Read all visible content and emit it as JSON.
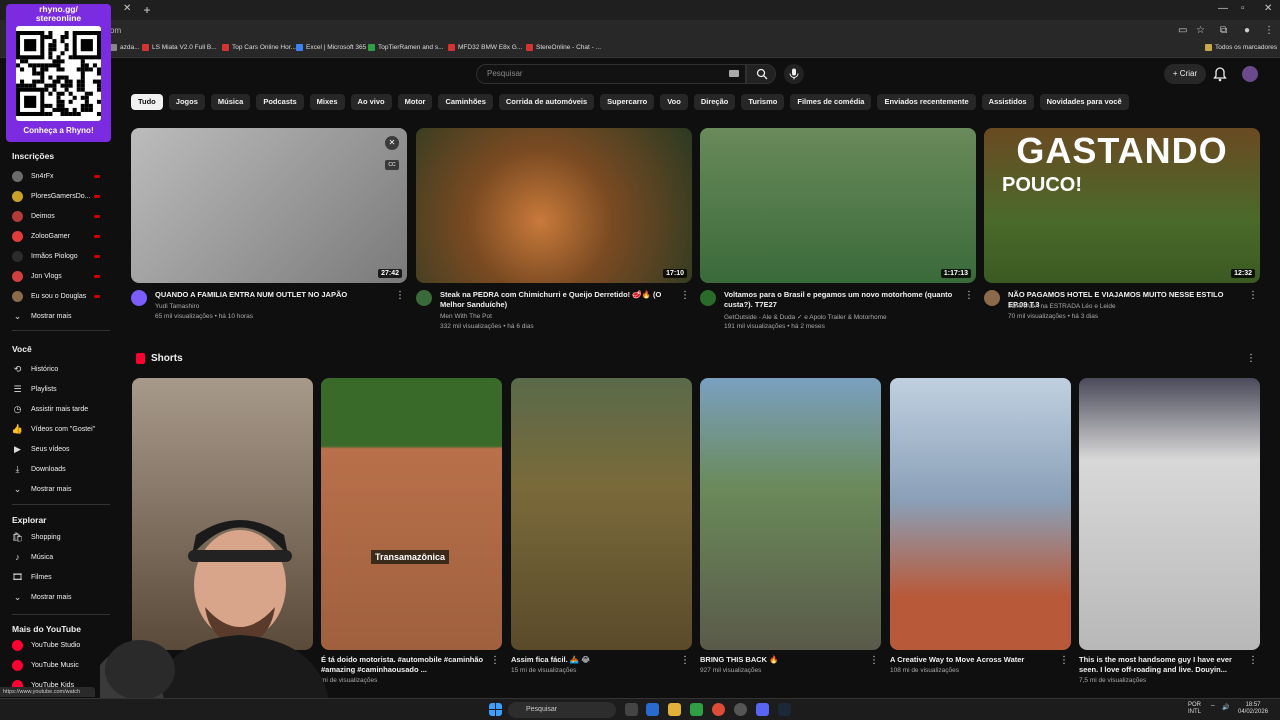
{
  "browser": {
    "url": "om",
    "bookmarks": [
      {
        "label": "azda...",
        "color": "#888888"
      },
      {
        "label": "LS Miata V2.0 Full B...",
        "color": "#d33333"
      },
      {
        "label": "Top Cars Online Hor...",
        "color": "#d33333"
      },
      {
        "label": "Excel | Microsoft 365",
        "color": "#3b82f6"
      },
      {
        "label": "TopTierRamen and s...",
        "color": "#2f9e44"
      },
      {
        "label": "MFD32 BMW E8x G...",
        "color": "#d33333"
      },
      {
        "label": "StereOnline - Chat - ...",
        "color": "#d33333"
      }
    ],
    "all_bookmarks": "Todos os marcadores",
    "status_url": "https://www.youtube.com/watch"
  },
  "overlay": {
    "line1": "rhyno.gg/",
    "line2": "stereonline",
    "caption": "Conheça a Rhyno!"
  },
  "header": {
    "search_placeholder": "Pesquisar",
    "create_label": "Criar"
  },
  "chips": [
    "Tudo",
    "Jogos",
    "Música",
    "Podcasts",
    "Mixes",
    "Ao vivo",
    "Motor",
    "Caminhões",
    "Corrida de automóveis",
    "Supercarro",
    "Voo",
    "Direção",
    "Turismo",
    "Filmes de comédia",
    "Enviados recentemente",
    "Assistidos",
    "Novidades para você"
  ],
  "sidebar": {
    "subscriptions_title": "Inscrições",
    "subscriptions": [
      {
        "label": "Sn4rFx",
        "color": "#6b6b6b",
        "live": true
      },
      {
        "label": "PloresGamersDo...",
        "color": "#c9a227",
        "live": true
      },
      {
        "label": "Deimos",
        "color": "#b33a3a",
        "live": true
      },
      {
        "label": "ZolooGamer",
        "color": "#e23b3b",
        "live": true
      },
      {
        "label": "Irmãos Piologo",
        "color": "#2c2c2c",
        "live": true
      },
      {
        "label": "Jon Vlogs",
        "color": "#d04040",
        "live": true
      },
      {
        "label": "Eu sou o Douglas",
        "color": "#8a6a4a",
        "live": true
      }
    ],
    "show_more": "Mostrar mais",
    "you_title": "Você",
    "you_items": [
      {
        "label": "Histórico",
        "icon": "history-icon",
        "glyph": "⟲"
      },
      {
        "label": "Playlists",
        "icon": "playlist-icon",
        "glyph": "☰"
      },
      {
        "label": "Assistir mais tarde",
        "icon": "clock-icon",
        "glyph": "◷"
      },
      {
        "label": "Vídeos com \"Gostei\"",
        "icon": "like-icon",
        "glyph": "👍"
      },
      {
        "label": "Seus vídeos",
        "icon": "video-icon",
        "glyph": "▶"
      },
      {
        "label": "Downloads",
        "icon": "download-icon",
        "glyph": "⤓"
      },
      {
        "label": "Mostrar mais",
        "icon": "chevron-down-icon",
        "glyph": "⌄"
      }
    ],
    "explore_title": "Explorar",
    "explore_items": [
      {
        "label": "Shopping",
        "icon": "shopping-icon",
        "glyph": "🛍"
      },
      {
        "label": "Música",
        "icon": "music-icon",
        "glyph": "♪"
      },
      {
        "label": "Filmes",
        "icon": "film-icon",
        "glyph": "🎞"
      },
      {
        "label": "Mostrar mais",
        "icon": "chevron-down-icon",
        "glyph": "⌄"
      }
    ],
    "more_title": "Mais do YouTube",
    "more_items": [
      {
        "label": "YouTube Studio"
      },
      {
        "label": "YouTube Music"
      },
      {
        "label": "YouTube Kids"
      }
    ]
  },
  "videos": [
    {
      "title": "QUANDO A FAMILIA ENTRA NUM OUTLET NO JAPÃO",
      "channel": "Yudi Tamashiro",
      "meta": "65 mil visualizações • há 10 horas",
      "duration": "27:42",
      "avatar_color": "#7a5cff",
      "thumb_color": "#9a9a9a"
    },
    {
      "title": "Steak na PEDRA com Chimichurri e Queijo Derretido! 🥩🔥 (O Melhor Sanduíche)",
      "channel": "Men With The Pot",
      "meta": "332 mil visualizações • há 6 dias",
      "duration": "17:10",
      "avatar_color": "#3a6a3a",
      "thumb_color": "#6a4a2a"
    },
    {
      "title": "Voltamos para o Brasil e pegamos um novo motorhome (quanto custa?). T7E27",
      "channel": "GetOutside - Ale & Duda ✓ e Apolo Trailer & Motorhome",
      "meta": "191 mil visualizações • há 2 meses",
      "duration": "1:17:13",
      "avatar_color": "#2a6a2a",
      "thumb_color": "#4a7a3a"
    },
    {
      "title": "NÃO PAGAMOS HOTEL E VIAJAMOS MUITO NESSE ESTILO EP.09 T.3",
      "channel": "JORNADA na ESTRADA Léo e Leide",
      "meta": "70 mil visualizações • há 3 dias",
      "duration": "12:32",
      "avatar_color": "#8a6a4a",
      "thumb_color": "#4a6a2a",
      "overlay_top": "GASTANDO",
      "overlay_bottom": "POUCO!"
    }
  ],
  "shorts": {
    "title": "Shorts",
    "items": [
      {
        "title": "",
        "views": "",
        "thumb_color": "#8a7a6a"
      },
      {
        "title": "É tá doido motorista. #automobile #caminhão #amazing #caminhaousado ...",
        "views": "mi de visualizações",
        "thumb_color": "#a86a4a",
        "tag": "Transamazônica"
      },
      {
        "title": "Assim fica fácil. 🚣 😂",
        "views": "15 mi de visualizações",
        "thumb_color": "#6a5a3a"
      },
      {
        "title": "BRING THIS BACK 🔥",
        "views": "927 mil visualizações",
        "thumb_color": "#5a7a4a"
      },
      {
        "title": "A Creative Way to Move Across Water",
        "views": "108 mi de visualizações",
        "thumb_color": "#7a9aba"
      },
      {
        "title": "This is the most handsome guy I have ever seen. I love off-roading and live. Douyin...",
        "views": "7,5 mi de visualizações",
        "thumb_color": "#c8c8c8"
      }
    ]
  },
  "taskbar": {
    "search": "Pesquisar",
    "lang1": "POR",
    "lang2": "INTL",
    "time": "18:57",
    "date": "04/02/2026"
  }
}
